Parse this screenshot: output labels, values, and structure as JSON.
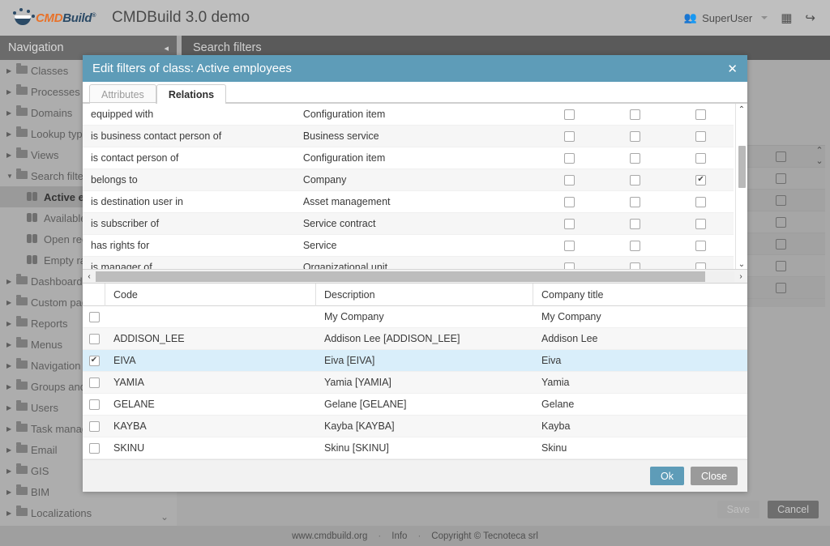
{
  "topbar": {
    "brand": {
      "c": "CMD",
      "b": "Build",
      "reg": "®"
    },
    "app_title": "CMDBuild 3.0 demo",
    "user_label": "SuperUser",
    "people_icon": "people-icon",
    "grid_icon": "▦",
    "logout_icon": "↪"
  },
  "sidebar": {
    "header": "Navigation",
    "collapse_icon": "◂",
    "items": [
      {
        "label": "Classes",
        "type": "folder"
      },
      {
        "label": "Processes",
        "type": "folder"
      },
      {
        "label": "Domains",
        "type": "folder"
      },
      {
        "label": "Lookup types",
        "type": "folder"
      },
      {
        "label": "Views",
        "type": "folder"
      },
      {
        "label": "Search filters",
        "type": "folder",
        "expanded": true
      },
      {
        "label": "Active employees",
        "type": "filter",
        "active": true
      },
      {
        "label": "Available assets",
        "type": "filter"
      },
      {
        "label": "Open requests",
        "type": "filter"
      },
      {
        "label": "Empty rack",
        "type": "filter"
      },
      {
        "label": "Dashboards",
        "type": "folder"
      },
      {
        "label": "Custom pages",
        "type": "folder"
      },
      {
        "label": "Reports",
        "type": "folder"
      },
      {
        "label": "Menus",
        "type": "folder"
      },
      {
        "label": "Navigation trees",
        "type": "folder"
      },
      {
        "label": "Groups and permissions",
        "type": "folder"
      },
      {
        "label": "Users",
        "type": "folder"
      },
      {
        "label": "Task manager",
        "type": "folder"
      },
      {
        "label": "Email",
        "type": "folder"
      },
      {
        "label": "GIS",
        "type": "folder"
      },
      {
        "label": "BIM",
        "type": "folder"
      },
      {
        "label": "Localizations",
        "type": "folder"
      }
    ],
    "scroll_down_icon": "⌄"
  },
  "main": {
    "header": "Search filters",
    "save_label": "Save",
    "cancel_label": "Cancel"
  },
  "modal": {
    "title": "Edit filters of class: Active employees",
    "close_icon": "✕",
    "tabs": [
      {
        "label": "Attributes",
        "active": false
      },
      {
        "label": "Relations",
        "active": true
      }
    ],
    "relations": [
      {
        "name": "equipped with",
        "target": "Configuration item",
        "c1": false,
        "c2": false,
        "c3": false
      },
      {
        "name": "is business contact person of",
        "target": "Business service",
        "c1": false,
        "c2": false,
        "c3": false
      },
      {
        "name": "is contact person of",
        "target": "Configuration item",
        "c1": false,
        "c2": false,
        "c3": false
      },
      {
        "name": "belongs to",
        "target": "Company",
        "c1": false,
        "c2": false,
        "c3": true
      },
      {
        "name": "is destination user in",
        "target": "Asset management",
        "c1": false,
        "c2": false,
        "c3": false
      },
      {
        "name": "is subscriber of",
        "target": "Service contract",
        "c1": false,
        "c2": false,
        "c3": false
      },
      {
        "name": "has rights for",
        "target": "Service",
        "c1": false,
        "c2": false,
        "c3": false
      },
      {
        "name": "is manager of",
        "target": "Organizational unit",
        "c1": false,
        "c2": false,
        "c3": false
      }
    ],
    "scroll": {
      "up_icon": "⌃",
      "down_icon": "⌄",
      "left_icon": "‹",
      "right_icon": "›"
    },
    "table": {
      "columns": [
        "Code",
        "Description",
        "Company title"
      ],
      "rows": [
        {
          "checked": false,
          "code": "",
          "description": "My Company",
          "company_title": "My Company",
          "selected": false
        },
        {
          "checked": false,
          "code": "ADDISON_LEE",
          "description": "Addison Lee [ADDISON_LEE]",
          "company_title": "Addison Lee",
          "selected": false
        },
        {
          "checked": true,
          "code": "EIVA",
          "description": "Eiva [EIVA]",
          "company_title": "Eiva",
          "selected": true
        },
        {
          "checked": false,
          "code": "YAMIA",
          "description": "Yamia [YAMIA]",
          "company_title": "Yamia",
          "selected": false
        },
        {
          "checked": false,
          "code": "GELANE",
          "description": "Gelane [GELANE]",
          "company_title": "Gelane",
          "selected": false
        },
        {
          "checked": false,
          "code": "KAYBA",
          "description": "Kayba [KAYBA]",
          "company_title": "Kayba",
          "selected": false
        },
        {
          "checked": false,
          "code": "SKINU",
          "description": "Skinu [SKINU]",
          "company_title": "Skinu",
          "selected": false
        }
      ]
    },
    "ok_label": "Ok",
    "close_label": "Close"
  },
  "footer": {
    "site": "www.cmdbuild.org",
    "info": "Info",
    "copyright": "Copyright © Tecnoteca srl",
    "sep": "·"
  },
  "colors": {
    "accent": "#5e9cb8",
    "selected_row": "#d9eefa",
    "topbar": "#bfbfbf",
    "sidebar": "#adadad",
    "brand_orange": "#e8722a",
    "brand_blue": "#2b4a66"
  }
}
